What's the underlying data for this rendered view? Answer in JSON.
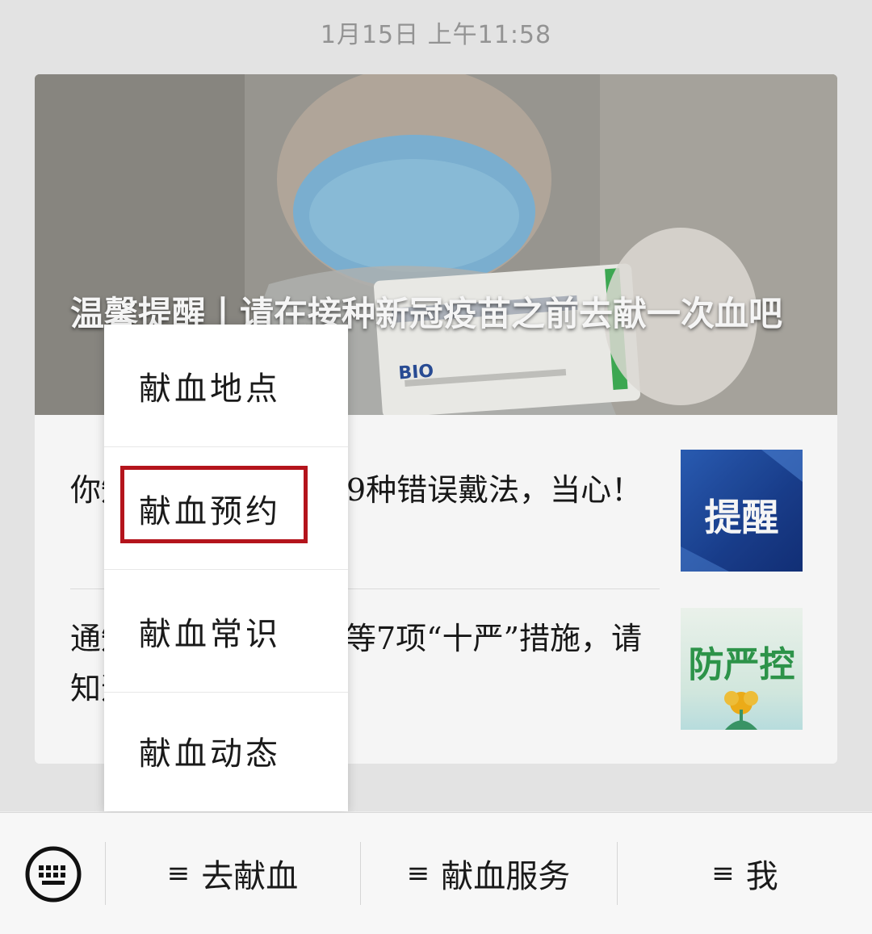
{
  "timestamp": "1月15日 上午11:58",
  "cover": {
    "title": "温馨提醒丨请在接种新冠疫苗之前去献一次血吧",
    "vial_label": "BIO"
  },
  "articles": [
    {
      "title": "你知道吗？戴口罩的9种错误戴法，当心！",
      "thumb_text": "提醒"
    },
    {
      "title": "通知 | 关于个人防护等7项“十严”措施，请知道！",
      "thumb_text": "防严控"
    }
  ],
  "popup_menu": {
    "items": [
      {
        "label": "献血地点"
      },
      {
        "label": "献血预约",
        "highlighted": true
      },
      {
        "label": "献血常识"
      },
      {
        "label": "献血动态"
      }
    ],
    "highlight_color": "#b4141c"
  },
  "bottom_bar": {
    "keyboard_icon": "keyboard-icon",
    "menus": [
      {
        "icon": "≡",
        "label": "去献血"
      },
      {
        "icon": "≡",
        "label": "献血服务"
      },
      {
        "icon": "≡",
        "label": "我"
      }
    ]
  }
}
